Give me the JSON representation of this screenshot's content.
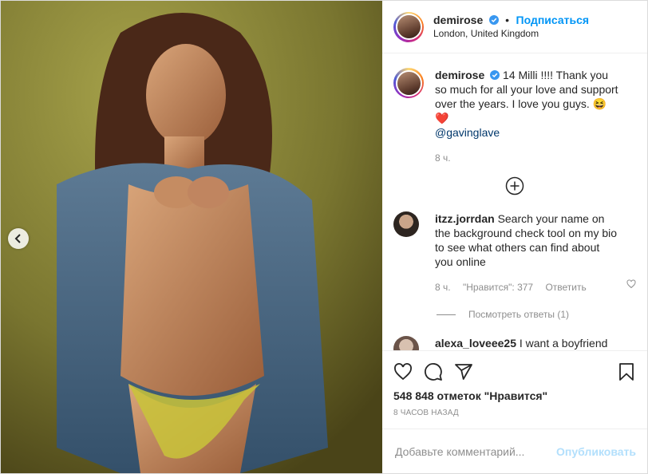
{
  "header": {
    "username": "demirose",
    "follow_label": "Подписаться",
    "dot": "•",
    "location": "London, United Kingdom"
  },
  "caption": {
    "username": "demirose",
    "text": "14 Milli !!!! Thank you so much for all your love and support over the years. I love you guys. 😆❤️",
    "mention": "@gavinglave",
    "time": "8 ч."
  },
  "comments": [
    {
      "username": "itzz.jorrdan",
      "text": "Search your name on the background check tool on my bio to see what others can find about you online",
      "time": "8 ч.",
      "likes": "\"Нравится\": 377",
      "reply_label": "Ответить",
      "view_replies": "Посмотреть ответы (1)"
    },
    {
      "username": "alexa_loveee25",
      "text": "I want a boyfriend"
    }
  ],
  "likes_text": "548 848 отметок \"Нравится\"",
  "posted_time": "8 часов назад",
  "add_comment": {
    "placeholder": "Добавьте комментарий...",
    "publish_label": "Опубликовать"
  },
  "colors": {
    "accent": "#0095f6",
    "publish_disabled": "#b2dffc",
    "muted": "#8e8e8e"
  }
}
